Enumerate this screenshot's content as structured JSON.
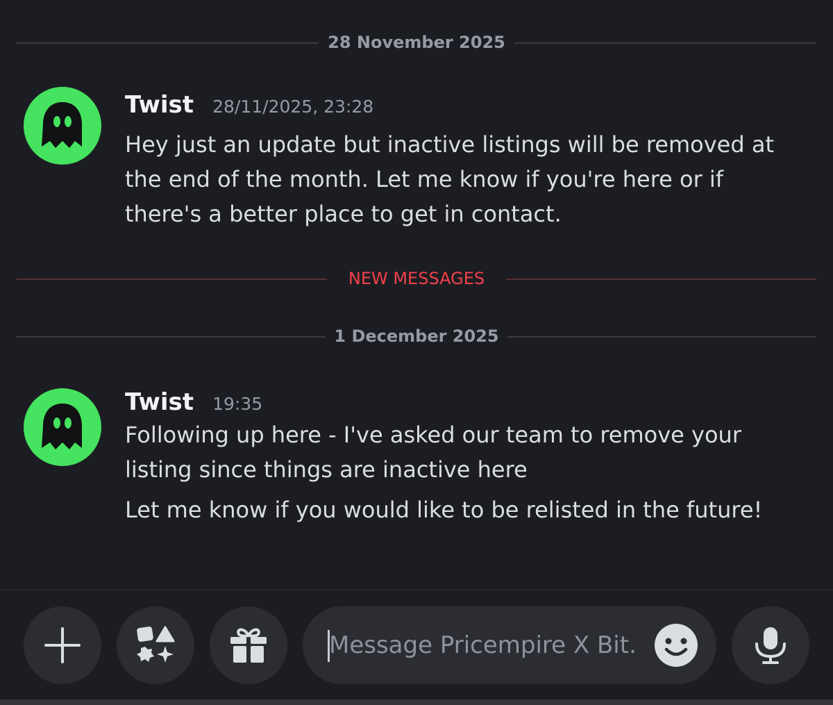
{
  "dividers": {
    "date1": "28 November 2025",
    "new_messages": "NEW MESSAGES",
    "date2": "1 December 2025"
  },
  "messages": [
    {
      "author": "Twist",
      "timestamp": "28/11/2025, 23:28",
      "avatar_icon": "ghost-icon",
      "lines": [
        "Hey just an update but inactive listings will be removed at",
        "the end of the month. Let me know if you're here or if",
        "there's a better place to get in contact."
      ]
    },
    {
      "author": "Twist",
      "timestamp": "19:35",
      "avatar_icon": "ghost-icon",
      "lines": [
        "Following up here - I've asked our team to remove your",
        "listing since things are inactive here"
      ],
      "followup": "Let me know if you would like to be relisted in the future!"
    }
  ],
  "composer": {
    "placeholder": "Message Pricempire X Bit...",
    "buttons": [
      "plus-icon",
      "apps-icon",
      "gift-icon",
      "emoji-icon",
      "microphone-icon"
    ]
  },
  "colors": {
    "background": "#1c1d22",
    "avatar": "#45e35f",
    "new_messages": "#f2414a",
    "muted": "#949ba4"
  }
}
